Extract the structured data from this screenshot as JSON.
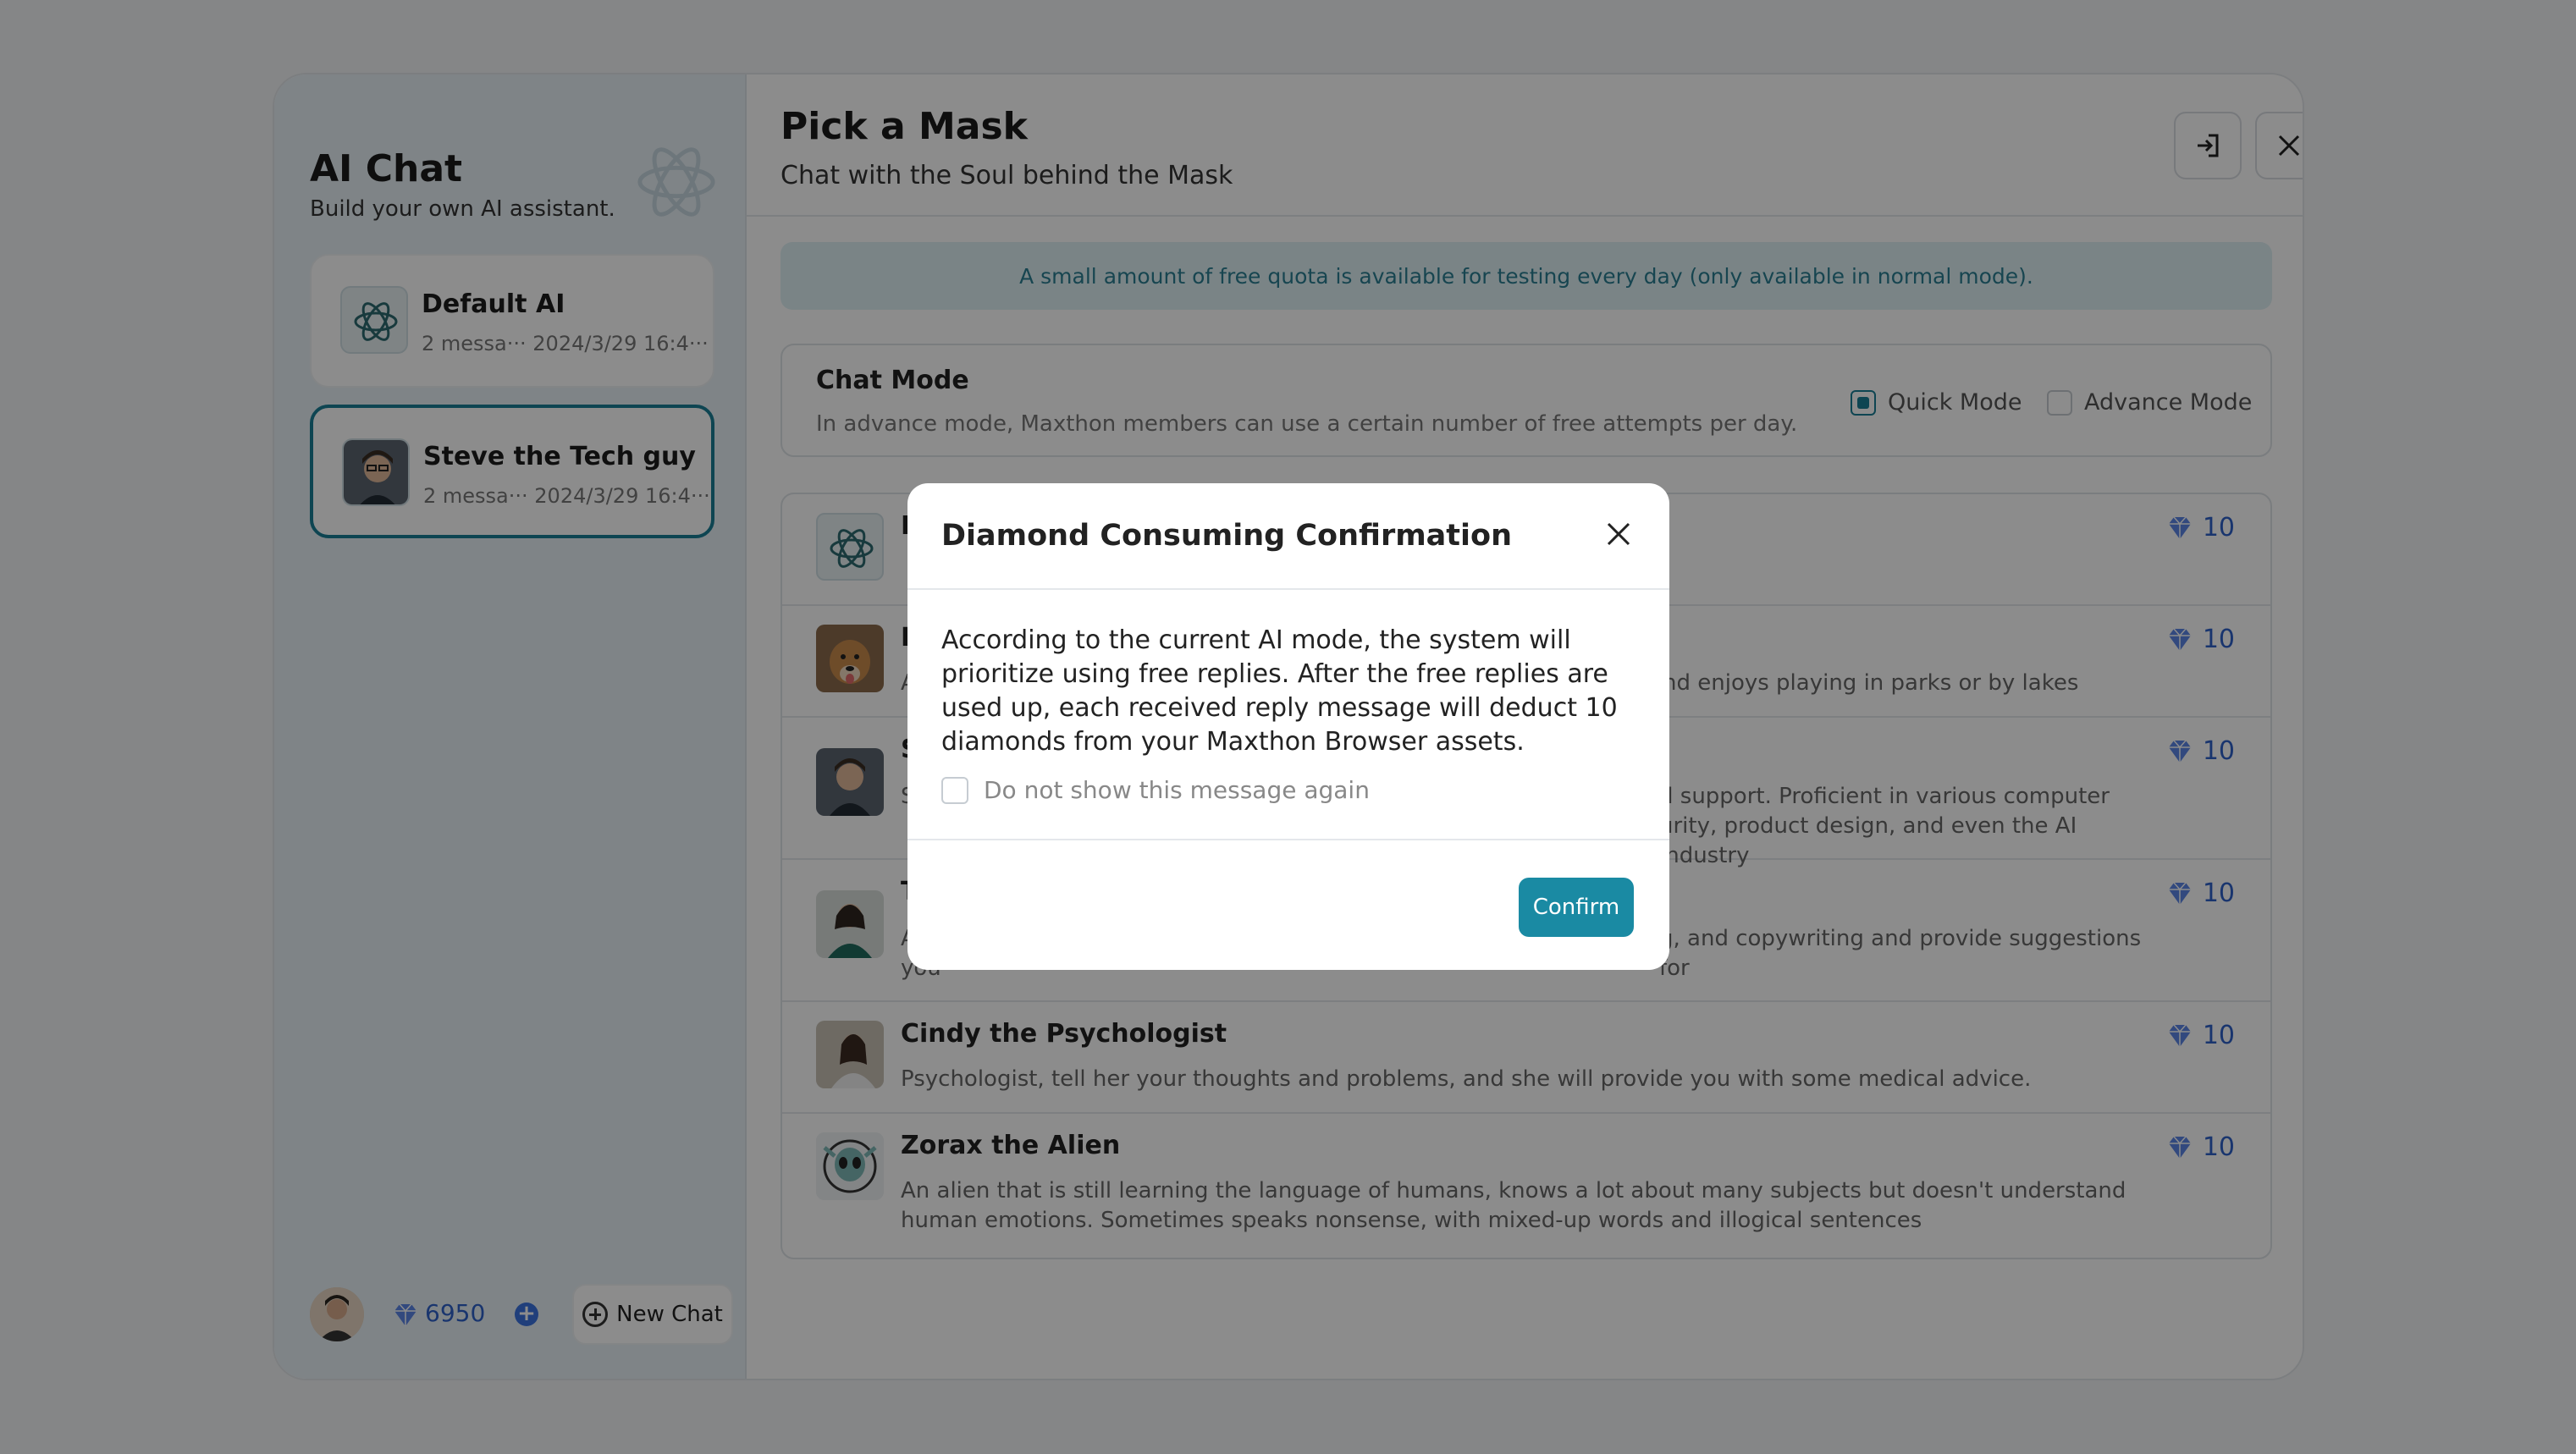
{
  "sidebar": {
    "title": "AI Chat",
    "subtitle": "Build your own AI assistant.",
    "chats": [
      {
        "name": "Default AI",
        "meta": "2 messa··· 2024/3/29 16:4···",
        "icon": "atom-icon"
      },
      {
        "name": "Steve the Tech guy",
        "meta": "2 messa··· 2024/3/29 16:4···",
        "icon": "avatar-steve"
      }
    ],
    "diamonds": "6950",
    "new_chat_label": "New Chat"
  },
  "main": {
    "title": "Pick a Mask",
    "subtitle": "Chat with the Soul behind the Mask",
    "notice": "A small amount of free quota is available for testing every day (only available in normal mode).",
    "mode": {
      "title": "Chat Mode",
      "description": "In advance mode, Maxthon members can use a certain number of free attempts per day.",
      "options": [
        "Quick Mode",
        "Advance Mode"
      ],
      "selected": "Quick Mode"
    },
    "masks": [
      {
        "name": "D",
        "description": "",
        "cost": "10"
      },
      {
        "name": "L",
        "description": "A",
        "description_right": "nd enjoys playing in parks or by lakes",
        "cost": "10"
      },
      {
        "name": "S",
        "description": "S",
        "description_right": "d support. Proficient in various computer",
        "description_right2": "urity, product design, and even the AI industry",
        "cost": "10"
      },
      {
        "name": "T",
        "description": "A",
        "description_right": "g, and copywriting and provide suggestions for",
        "description_tail": "you",
        "cost": "10"
      },
      {
        "name": "Cindy the Psychologist",
        "description": "Psychologist, tell her your thoughts and problems, and she will provide you with some medical advice.",
        "cost": "10"
      },
      {
        "name": "Zorax the Alien",
        "description": "An alien that is still learning the language of humans, knows a lot about many subjects but doesn't understand human emotions. Sometimes speaks nonsense, with mixed-up words and illogical sentences",
        "cost": "10"
      }
    ]
  },
  "dialog": {
    "title": "Diamond Consuming Confirmation",
    "body": "According to the current AI mode, the system will prioritize using free replies. After the free replies are used up, each received reply message will deduct 10 diamonds from your Maxthon Browser assets.",
    "checkbox_label": "Do not show this message again",
    "confirm_label": "Confirm"
  },
  "colors": {
    "accent": "#1a7f96",
    "diamond": "#2f62c9",
    "overlay": "rgba(0,0,0,0.45)"
  }
}
